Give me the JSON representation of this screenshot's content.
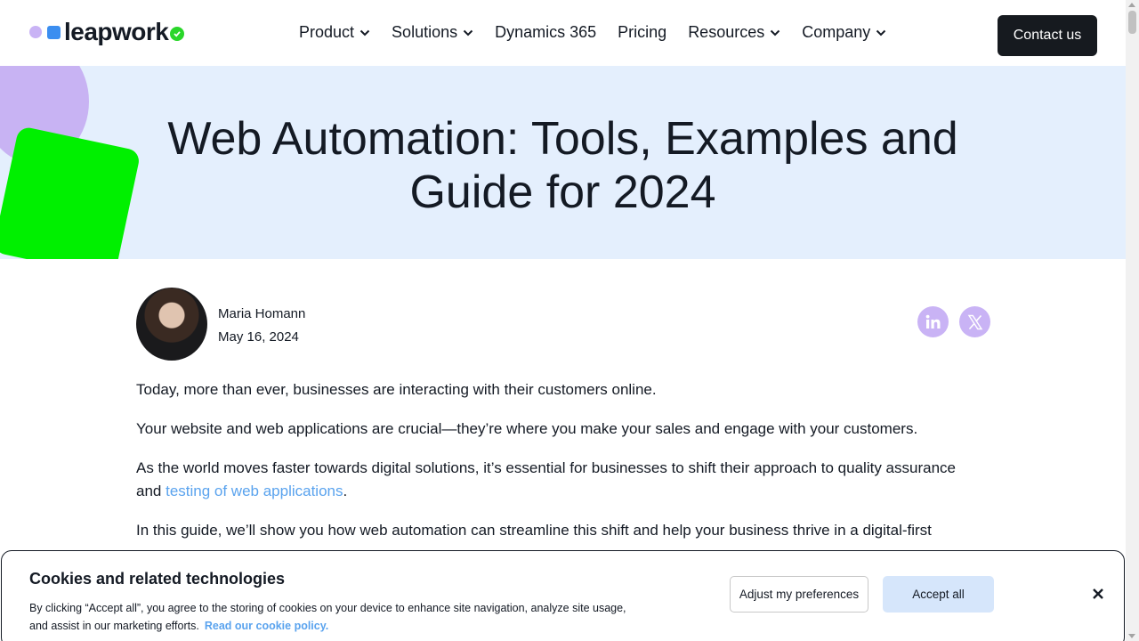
{
  "header": {
    "logo_text": "leapwork",
    "nav": [
      {
        "label": "Product",
        "has_dropdown": true
      },
      {
        "label": "Solutions",
        "has_dropdown": true
      },
      {
        "label": "Dynamics 365",
        "has_dropdown": false
      },
      {
        "label": "Pricing",
        "has_dropdown": false
      },
      {
        "label": "Resources",
        "has_dropdown": true
      },
      {
        "label": "Company",
        "has_dropdown": true
      }
    ],
    "contact_label": "Contact us"
  },
  "hero": {
    "title_line1": "Web Automation: Tools, Examples and",
    "title_line2": "Guide for 2024"
  },
  "author": {
    "name": "Maria Homann",
    "date": "May 16, 2024"
  },
  "share": {
    "linkedin_icon": "linkedin-icon",
    "x_icon": "x-twitter-icon"
  },
  "article": {
    "p1": "Today, more than ever, businesses are interacting with their customers online.",
    "p2": "Your website and web applications are crucial—they’re where you make your sales and engage with your customers.",
    "p3_before": "As the world moves faster towards digital solutions, it’s essential for businesses to shift their approach to quality assurance and ",
    "p3_link": "testing of web applications",
    "p3_after": ".",
    "p4": "In this guide, we’ll show you how web automation can streamline this shift and help your business thrive in a digital-first"
  },
  "cookie": {
    "title": "Cookies and related technologies",
    "text": "By clicking “Accept all”, you agree to the storing of cookies on your device to enhance site navigation, analyze site usage, and assist in our marketing efforts.",
    "link": "Read our cookie policy.",
    "adjust_label": "Adjust my preferences",
    "accept_label": "Accept all"
  },
  "colors": {
    "brand_purple": "#c9b3f5",
    "brand_blue": "#3b8ef0",
    "brand_green": "#00f000",
    "hero_bg": "#e4effd",
    "link": "#5aa3ee"
  }
}
